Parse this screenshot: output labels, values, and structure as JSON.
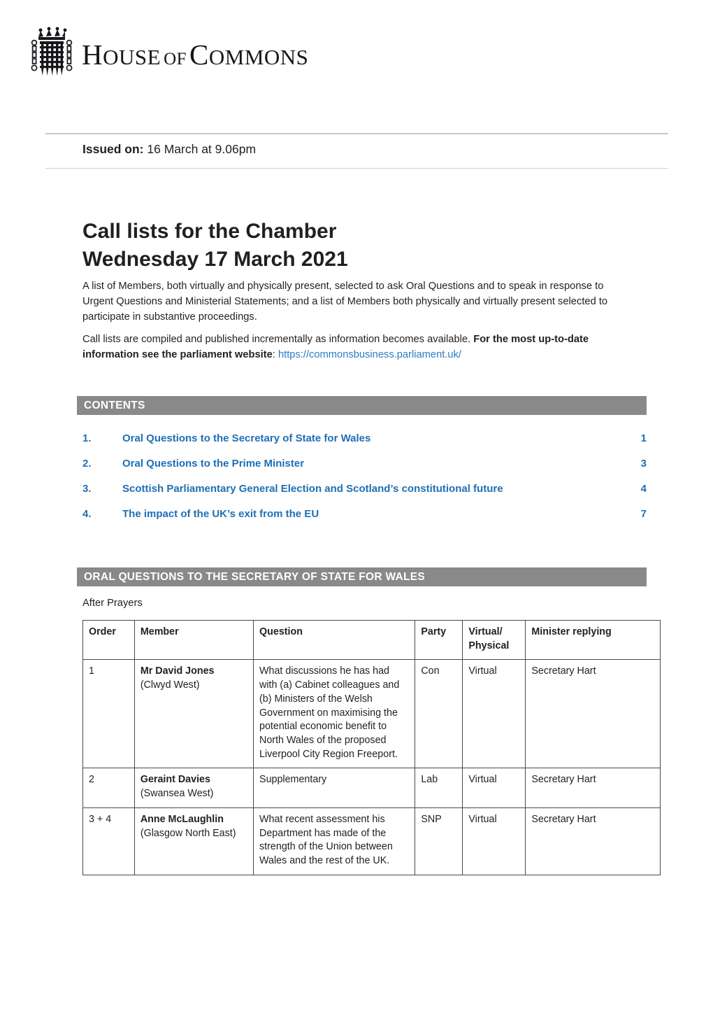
{
  "masthead": {
    "crest_icon": "portcullis-crowned-icon",
    "wordmark": {
      "h": "H",
      "ouse": "OUSE",
      "of": "OF",
      "c": "C",
      "ommons": "OMMONS"
    }
  },
  "issued": {
    "label": "Issued on:",
    "value": "16 March at 9.06pm"
  },
  "title": {
    "line1": "Call lists for the Chamber",
    "line2": "Wednesday 17 March 2021"
  },
  "intro": {
    "paragraph1": "A list of Members, both virtually and physically present, selected to ask Oral Questions and to speak in response to Urgent Questions and Ministerial Statements; and a list of Members both physically and virtually present selected to participate in substantive proceedings.",
    "paragraph2_plain": "Call lists are compiled and published incrementally as information becomes available. ",
    "paragraph2_bold": "For the most up-to-date information see the parliament website",
    "paragraph2_colon": ": ",
    "link_text": "https://commonsbusiness.parliament.uk/",
    "link_color": "#2b7cc0"
  },
  "contents": {
    "heading": "CONTENTS",
    "items": [
      {
        "num": "1.",
        "label": "Oral Questions to the Secretary of State for Wales",
        "page": "1"
      },
      {
        "num": "2.",
        "label": "Oral Questions to the Prime Minister",
        "page": "3"
      },
      {
        "num": "3.",
        "label": "Scottish Parliamentary General Election and Scotland’s constitutional future",
        "page": "4"
      },
      {
        "num": "4.",
        "label": "The impact of the UK’s exit from the EU",
        "page": "7"
      }
    ],
    "link_color": "#1f6fb5",
    "bar_color": "#898989"
  },
  "section": {
    "heading": "ORAL QUESTIONS TO THE SECRETARY OF STATE FOR WALES",
    "subheading": "After Prayers"
  },
  "table": {
    "columns": {
      "order": "Order",
      "member": "Member",
      "question": "Question",
      "party": "Party",
      "virtual_physical_line1": "Virtual/",
      "virtual_physical_line2": "Physical",
      "minister": "Minister replying"
    },
    "rows": [
      {
        "order": "1",
        "member_name": "Mr David Jones",
        "member_seat": "(Clwyd West)",
        "question": "What discussions he has had with (a) Cabinet colleagues and (b) Ministers of the Welsh Government on maximising the potential economic benefit to North Wales of the proposed Liverpool City Region Freeport.",
        "party": "Con",
        "virtual_physical": "Virtual",
        "minister": "Secretary Hart"
      },
      {
        "order": "2",
        "member_name": "Geraint Davies",
        "member_seat": "(Swansea West)",
        "question": "Supplementary",
        "party": "Lab",
        "virtual_physical": "Virtual",
        "minister": "Secretary Hart"
      },
      {
        "order": "3 + 4",
        "member_name": "Anne McLaughlin",
        "member_seat": "(Glasgow North East)",
        "question": "What recent assessment his Department has made of the strength of the Union between Wales and the rest of the UK.",
        "party": "SNP",
        "virtual_physical": "Virtual",
        "minister": "Secretary Hart"
      }
    ]
  }
}
